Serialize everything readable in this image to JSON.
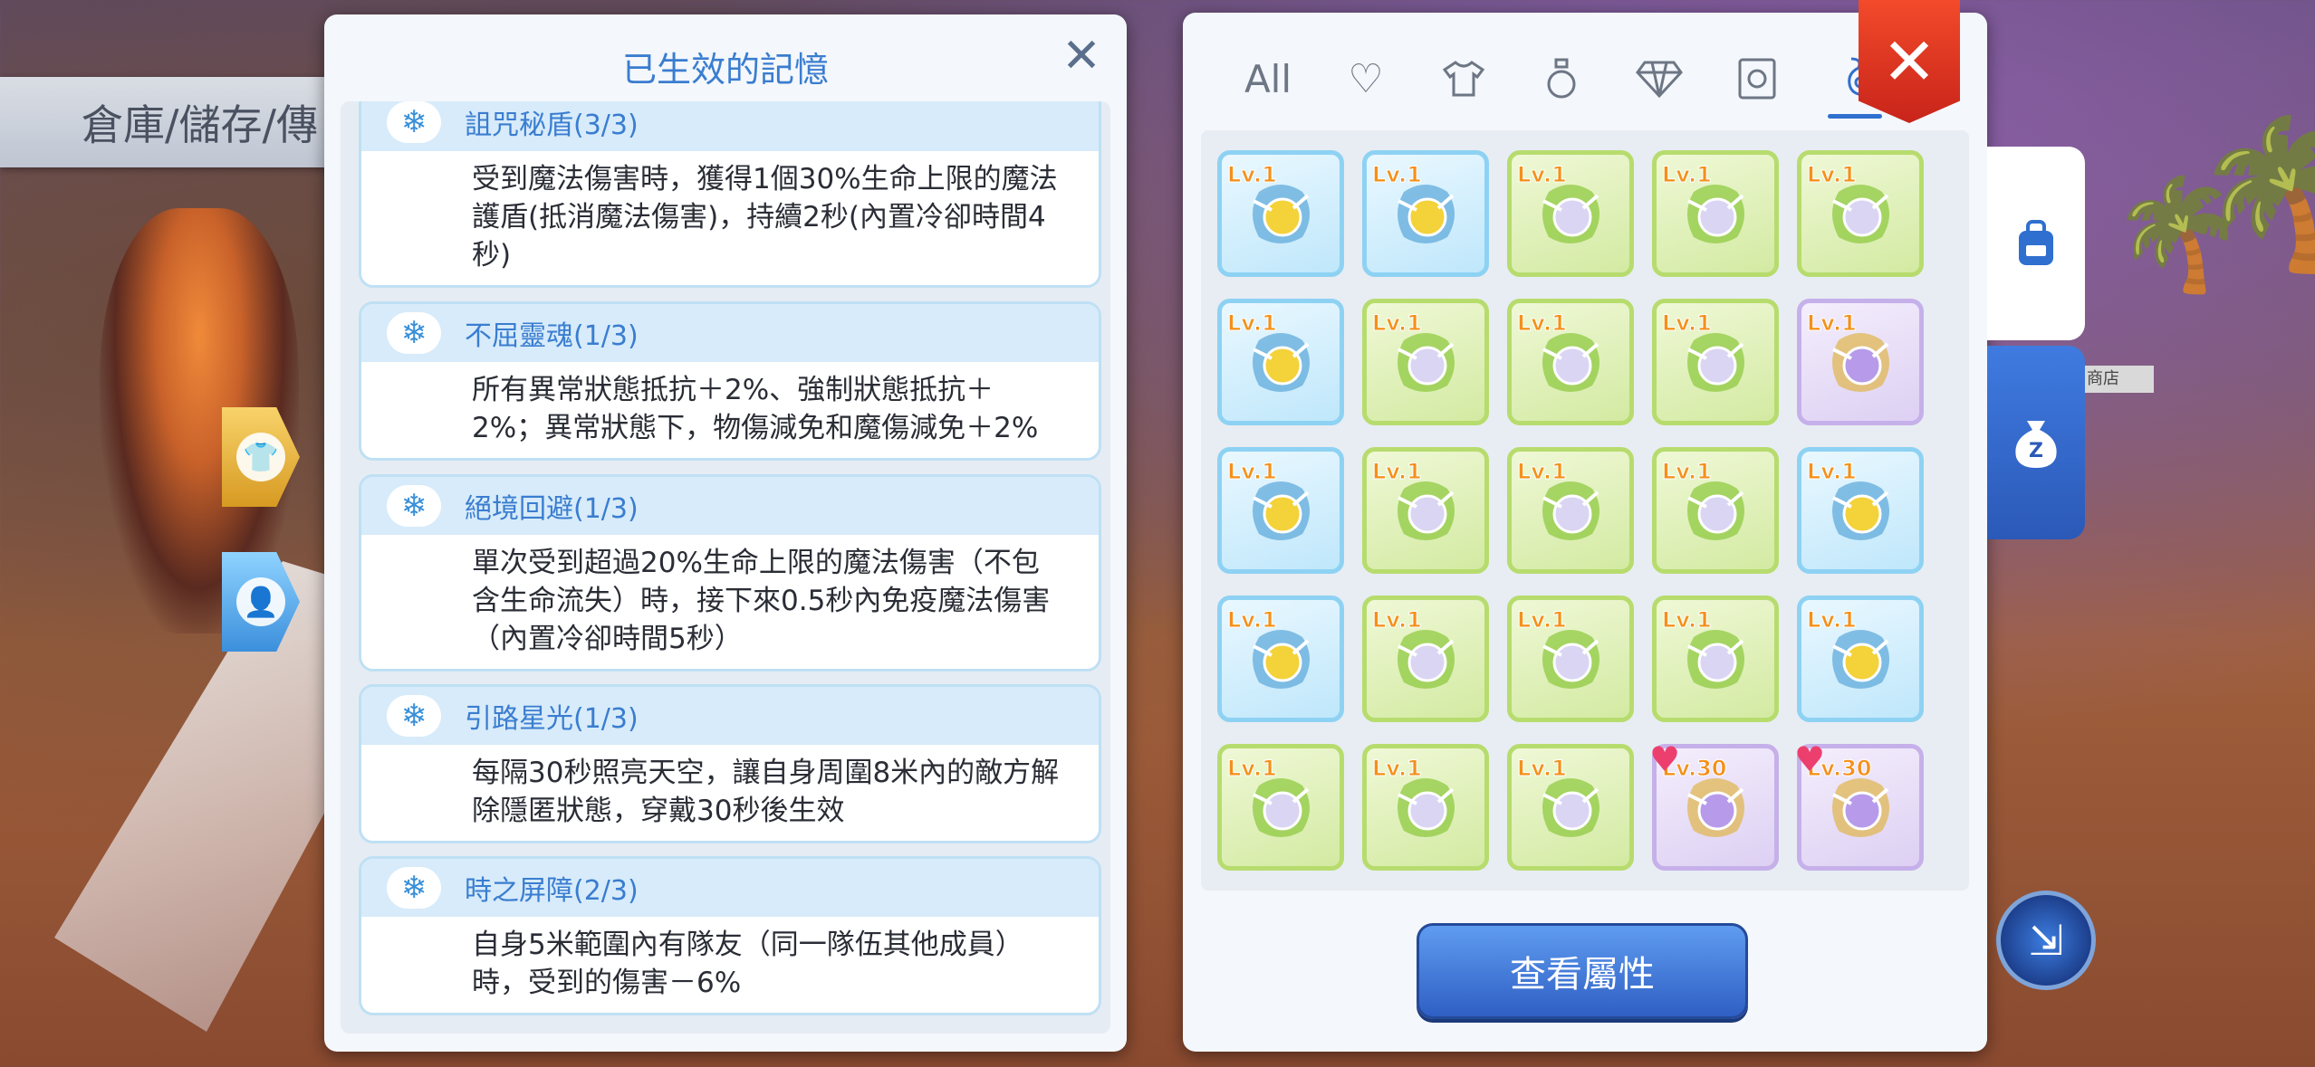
{
  "background": {
    "sign_text": "倉庫/儲存/傳",
    "shop_tag": "商店"
  },
  "memory": {
    "title": "已生效的記憶",
    "items": [
      {
        "name": "詛咒秘盾(3/3)",
        "desc": "受到魔法傷害時，獲得1個30%生命上限的魔法護盾(抵消魔法傷害)，持續2秒(內置冷卻時間4秒)"
      },
      {
        "name": "不屈靈魂(1/3)",
        "desc": "所有異常狀態抵抗＋2%、強制狀態抵抗＋2%；異常狀態下，物傷減免和魔傷減免＋2%"
      },
      {
        "name": "絕境回避(1/3)",
        "desc": "單次受到超過20%生命上限的魔法傷害（不包含生命流失）時，接下來0.5秒內免疫魔法傷害（內置冷卻時間5秒）"
      },
      {
        "name": "引路星光(1/3)",
        "desc": "每隔30秒照亮天空，讓自身周圍8米內的敵方解除隱匿狀態，穿戴30秒後生效"
      },
      {
        "name": "時之屏障(2/3)",
        "desc": "自身5米範圍內有隊友（同一隊伍其他成員）時，受到的傷害－6%"
      }
    ]
  },
  "inventory": {
    "tabs": [
      {
        "label": "All",
        "icon": "all-text"
      },
      {
        "label": "",
        "icon": "heart-icon"
      },
      {
        "label": "",
        "icon": "shirt-icon"
      },
      {
        "label": "",
        "icon": "potion-icon"
      },
      {
        "label": "",
        "icon": "diamond-icon"
      },
      {
        "label": "",
        "icon": "card-icon"
      },
      {
        "label": "",
        "icon": "memory-icon"
      }
    ],
    "active_tab": 6,
    "slots": [
      {
        "color": "blue",
        "level": "Lv.1",
        "heart": false
      },
      {
        "color": "blue",
        "level": "Lv.1",
        "heart": false
      },
      {
        "color": "green",
        "level": "Lv.1",
        "heart": false
      },
      {
        "color": "green",
        "level": "Lv.1",
        "heart": false
      },
      {
        "color": "green",
        "level": "Lv.1",
        "heart": false
      },
      {
        "color": "blue",
        "level": "Lv.1",
        "heart": false
      },
      {
        "color": "green",
        "level": "Lv.1",
        "heart": false
      },
      {
        "color": "green",
        "level": "Lv.1",
        "heart": false
      },
      {
        "color": "green",
        "level": "Lv.1",
        "heart": false
      },
      {
        "color": "purple",
        "level": "Lv.1",
        "heart": false
      },
      {
        "color": "blue",
        "level": "Lv.1",
        "heart": false
      },
      {
        "color": "green",
        "level": "Lv.1",
        "heart": false
      },
      {
        "color": "green",
        "level": "Lv.1",
        "heart": false
      },
      {
        "color": "green",
        "level": "Lv.1",
        "heart": false
      },
      {
        "color": "blue",
        "level": "Lv.1",
        "heart": false
      },
      {
        "color": "blue",
        "level": "Lv.1",
        "heart": false
      },
      {
        "color": "green",
        "level": "Lv.1",
        "heart": false
      },
      {
        "color": "green",
        "level": "Lv.1",
        "heart": false
      },
      {
        "color": "green",
        "level": "Lv.1",
        "heart": false
      },
      {
        "color": "blue",
        "level": "Lv.1",
        "heart": false
      },
      {
        "color": "green",
        "level": "Lv.1",
        "heart": false
      },
      {
        "color": "green",
        "level": "Lv.1",
        "heart": false
      },
      {
        "color": "green",
        "level": "Lv.1",
        "heart": false
      },
      {
        "color": "purple",
        "level": "Lv.30",
        "heart": true
      },
      {
        "color": "purple",
        "level": "Lv.30",
        "heart": true
      }
    ],
    "view_attributes_label": "查看屬性",
    "close_label": "✕"
  },
  "colors": {
    "accent_blue": "#3a7dd0",
    "close_red": "#e0321e",
    "slot_blue": "#8ed2f3",
    "slot_green": "#b7dc6e",
    "slot_purple": "#c6b0ea",
    "level_orange": "#f4901a"
  }
}
